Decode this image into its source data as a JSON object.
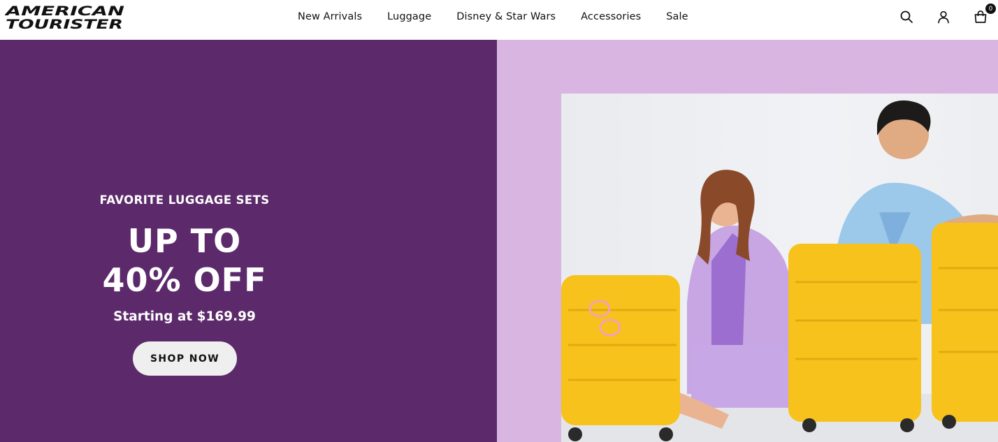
{
  "brand": {
    "logo_line1": "AMERICAN",
    "logo_line2": "TOURISTER"
  },
  "nav": {
    "items": [
      {
        "label": "New Arrivals"
      },
      {
        "label": "Luggage"
      },
      {
        "label": "Disney & Star Wars"
      },
      {
        "label": "Accessories"
      },
      {
        "label": "Sale"
      }
    ]
  },
  "header_icons": {
    "search": "search-icon",
    "account": "user-icon",
    "cart": "bag-icon",
    "cart_count": "0"
  },
  "hero": {
    "eyebrow": "FAVORITE LUGGAGE SETS",
    "headline_line1": "UP TO",
    "headline_line2": "40% OFF",
    "subline": "Starting at $169.99",
    "cta_label": "SHOP NOW",
    "left_bg": "#5c2a6b",
    "right_bg": "#d9b5e2",
    "suitcase_color": "#f7c21c"
  }
}
